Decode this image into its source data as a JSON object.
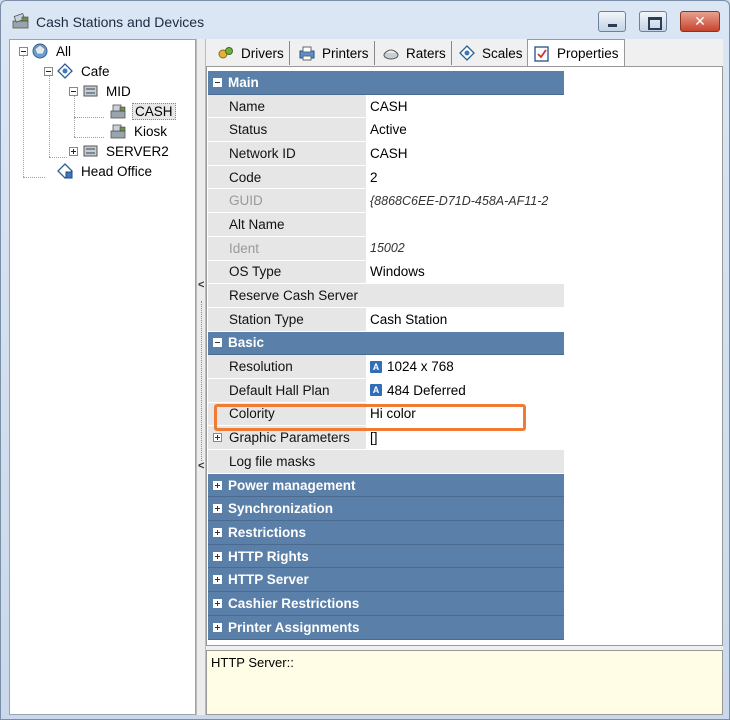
{
  "window": {
    "title": "Cash Stations and Devices",
    "close_glyph": "✕"
  },
  "tree": {
    "nodes": [
      {
        "label": "All",
        "icon": "globe-icon"
      },
      {
        "label": "Cafe",
        "icon": "restaurant-icon"
      },
      {
        "label": "MID",
        "icon": "server-icon"
      },
      {
        "label": "CASH",
        "icon": "cash-register-icon",
        "selected": true
      },
      {
        "label": "Kiosk",
        "icon": "cash-register-icon"
      },
      {
        "label": "SERVER2",
        "icon": "server-icon"
      },
      {
        "label": "Head Office",
        "icon": "office-icon"
      }
    ]
  },
  "splitter": {
    "arrow_top": "<",
    "arrow_bottom": "<"
  },
  "tabs": [
    {
      "label": "Drivers",
      "icon": "drivers-icon"
    },
    {
      "label": "Printers",
      "icon": "printer-icon"
    },
    {
      "label": "Raters",
      "icon": "rater-icon"
    },
    {
      "label": "Scales",
      "icon": "scales-icon"
    },
    {
      "label": "Properties",
      "icon": "properties-icon",
      "active": true
    }
  ],
  "properties": {
    "main": {
      "title": "Main",
      "rows": [
        {
          "name": "Name",
          "value": "CASH"
        },
        {
          "name": "Status",
          "value": "Active"
        },
        {
          "name": "Network ID",
          "value": "CASH"
        },
        {
          "name": "Code",
          "value": "2"
        },
        {
          "name": "GUID",
          "value": "{8868C6EE-D71D-458A-AF11-2",
          "dim": true,
          "italic": true
        },
        {
          "name": "Alt Name",
          "value": ""
        },
        {
          "name": "Ident",
          "value": "15002",
          "dim": true,
          "italic": true
        },
        {
          "name": "OS Type",
          "value": "Windows"
        },
        {
          "name": "Reserve Cash Server",
          "value": ""
        },
        {
          "name": "Station Type",
          "value": "Cash Station"
        }
      ]
    },
    "basic": {
      "title": "Basic",
      "rows": [
        {
          "name": "Resolution",
          "value": "1024 x 768",
          "badge": "A"
        },
        {
          "name": "Default Hall Plan",
          "value": "484 Deferred",
          "badge": "A",
          "highlighted": true
        },
        {
          "name": "Colority",
          "value": "Hi color"
        },
        {
          "name": "Graphic Parameters",
          "value": "[]",
          "expandable": true
        },
        {
          "name": "Log file masks",
          "value": ""
        }
      ]
    },
    "collapsed_categories": [
      "Power management",
      "Synchronization",
      "Restrictions",
      "HTTP Rights",
      "HTTP Server",
      "Cashier Restrictions",
      "Printer Assignments"
    ]
  },
  "description": {
    "text": "HTTP Server::"
  },
  "colors": {
    "category_header": "#5a7fa8",
    "highlight_border": "#f07c33",
    "description_bg": "#fffde6"
  }
}
